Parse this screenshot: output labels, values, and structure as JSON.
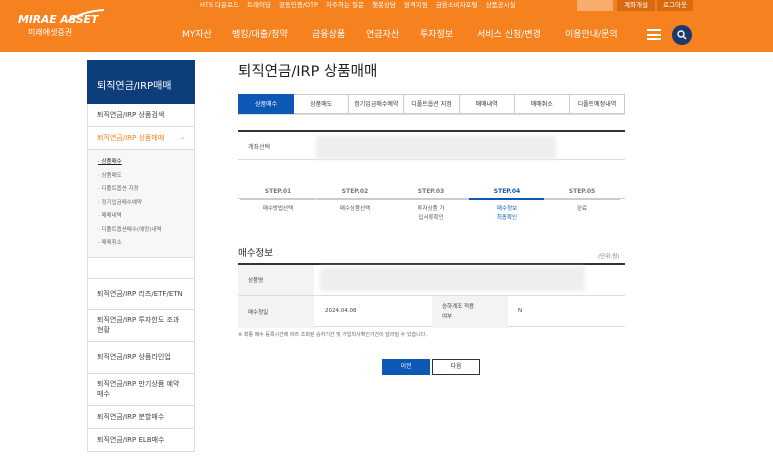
{
  "header": {
    "logo": {
      "main": "MIRAE ASSET",
      "sub": "미래에셋증권"
    },
    "util_links": [
      "HTS 다운로드",
      "트레이딩",
      "공동인증/OTP",
      "자주하는 질문",
      "챗봇상담",
      "원격지원",
      "금융소비자포털",
      "상품공시실"
    ],
    "login_buttons": [
      "계좌개설",
      "로그아웃"
    ],
    "gnb": [
      "MY자산",
      "뱅킹/대출/청약",
      "금융상품",
      "연금자산",
      "투자정보",
      "서비스 신청/변경",
      "이용안내/문의"
    ],
    "icons": {
      "menu": "hamburger-icon",
      "search": "search-icon"
    },
    "colors": {
      "brand": "#f5821f",
      "search_bg": "#1a3a6e"
    }
  },
  "lnb": {
    "title": "퇴직연금/IRP매매",
    "items_top": [
      "퇴직연금/IRP 상품검색",
      "퇴직연금/IRP 상품매매"
    ],
    "sub_items": [
      "상품매수",
      "상품매도",
      "디폴트옵션 지정",
      "정기입금매수예약",
      "매매내역",
      "디폴트옵션매수(예정)내역",
      "매매취소"
    ],
    "items_bottom": [
      "퇴직연금/IRP 리츠/ETF/ETN",
      "퇴직연금/IRP 투자한도 조과현황",
      "퇴직연금/IRP 상품라인업",
      "퇴직연금/IRP 만기상품 예약매수",
      "퇴직연금/IRP 분할매수",
      "퇴직연금/IRP ELB매수"
    ]
  },
  "page": {
    "title": "퇴직연금/IRP 상품매매",
    "tabs": [
      "상품매수",
      "상품매도",
      "정기입금매수예약",
      "디폴트옵션 지정",
      "매매내역",
      "매매취소",
      "디폴트예정내역"
    ],
    "active_tab": 0,
    "account_label": "계좌선택",
    "steps": [
      {
        "num": "STEP.01",
        "label": "매수방법선택"
      },
      {
        "num": "STEP.02",
        "label": "매수상품선택"
      },
      {
        "num": "STEP.03",
        "label": "투자상품 가입서류확인"
      },
      {
        "num": "STEP.04",
        "label": "매수정보 최종확인"
      },
      {
        "num": "STEP.05",
        "label": "완료"
      }
    ],
    "active_step": 3,
    "section_title": "매수정보",
    "unit": "(단위:원)",
    "info": {
      "product_label": "상품명",
      "date_label": "매수청일",
      "date_value": "2024.04.08",
      "auto_label": "승하계조 적용여부",
      "auto_value": "N"
    },
    "note": "※ 최종 매수 등록시간에 따라 조회된 승하기간 및 가입되사확인기간이 달라질 수 있습니다.",
    "buttons": {
      "prev": "이전",
      "next": "다음"
    },
    "colors": {
      "accent": "#0d57b5",
      "lnb_title": "#0d3d7a"
    }
  }
}
